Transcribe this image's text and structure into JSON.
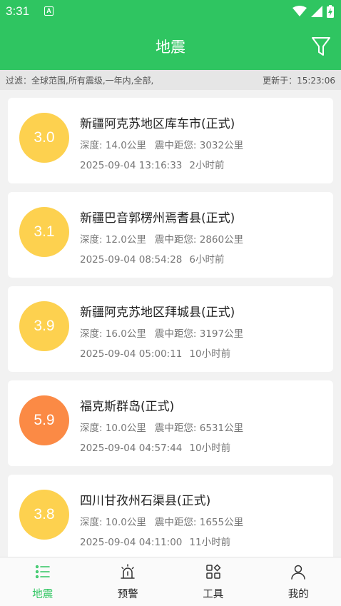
{
  "status_bar": {
    "time": "3:31",
    "app_icon_letter": "A"
  },
  "header": {
    "title": "地震"
  },
  "filter_bar": {
    "filter_text": "过滤：全球范围,所有震级,一年内,全部,",
    "updated_text": "更新于：15:23:06"
  },
  "earthquakes": [
    {
      "magnitude": "3.0",
      "place": "新疆阿克苏地区库车市(正式)",
      "depth": "深度: 14.0公里",
      "distance": "震中距您: 3032公里",
      "datetime": "2025-09-04 13:16:33",
      "ago": "2小时前",
      "color": "#fdd14f"
    },
    {
      "magnitude": "3.1",
      "place": "新疆巴音郭楞州焉耆县(正式)",
      "depth": "深度: 12.0公里",
      "distance": "震中距您: 2860公里",
      "datetime": "2025-09-04 08:54:28",
      "ago": "6小时前",
      "color": "#fdd14f"
    },
    {
      "magnitude": "3.9",
      "place": "新疆阿克苏地区拜城县(正式)",
      "depth": "深度: 16.0公里",
      "distance": "震中距您: 3197公里",
      "datetime": "2025-09-04 05:00:11",
      "ago": "10小时前",
      "color": "#fdd14f"
    },
    {
      "magnitude": "5.9",
      "place": "福克斯群岛(正式)",
      "depth": "深度: 10.0公里",
      "distance": "震中距您: 6531公里",
      "datetime": "2025-09-04 04:57:44",
      "ago": "10小时前",
      "color": "#fb8a45"
    },
    {
      "magnitude": "3.8",
      "place": "四川甘孜州石渠县(正式)",
      "depth": "深度: 10.0公里",
      "distance": "震中距您: 1655公里",
      "datetime": "2025-09-04 04:11:00",
      "ago": "11小时前",
      "color": "#fdd14f"
    }
  ],
  "tabs": [
    {
      "label": "地震",
      "icon": "list-icon",
      "active": true
    },
    {
      "label": "预警",
      "icon": "alarm-icon",
      "active": false
    },
    {
      "label": "工具",
      "icon": "grid-icon",
      "active": false
    },
    {
      "label": "我的",
      "icon": "user-icon",
      "active": false
    }
  ],
  "colors": {
    "primary": "#2fc561",
    "mag_low": "#fdd14f",
    "mag_high": "#fb8a45"
  }
}
